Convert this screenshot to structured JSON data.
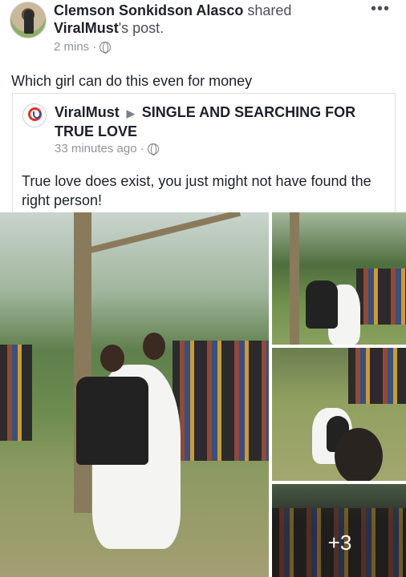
{
  "post": {
    "author": "Clemson Sonkidson Alasco",
    "action_word": "shared",
    "shared_from": "ViralMust",
    "possessive": "'s post.",
    "time": "2 mins",
    "visibility_icon": "globe-icon",
    "menu_icon": "more-options-icon",
    "caption": "Which girl can do this even for money"
  },
  "shared_post": {
    "page_name": "ViralMust",
    "arrow": "▶",
    "group_name": "SINGLE AND SEARCHING FOR TRUE LOVE",
    "time": "33 minutes ago",
    "text": "True love does exist, you just might not have found the right person!"
  },
  "photos": {
    "more_count": "+3"
  }
}
